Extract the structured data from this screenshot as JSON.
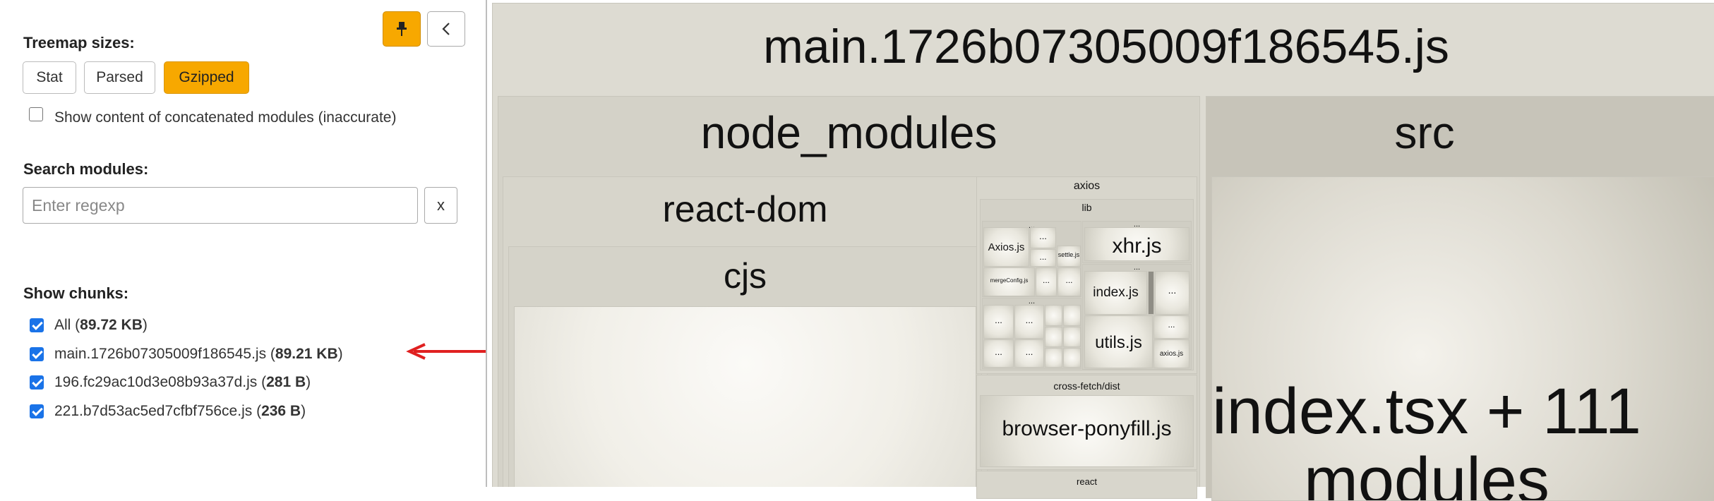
{
  "sidebar": {
    "treemap_sizes_label": "Treemap sizes:",
    "size_buttons": [
      {
        "label": "Stat",
        "active": false
      },
      {
        "label": "Parsed",
        "active": false
      },
      {
        "label": "Gzipped",
        "active": true
      }
    ],
    "concat_label": "Show content of concatenated modules (inaccurate)",
    "search_label": "Search modules:",
    "search_placeholder": "Enter regexp",
    "search_value": "",
    "clear_label": "x",
    "chunks_label": "Show chunks:",
    "chunks": [
      {
        "name": "All",
        "size": "89.72 KB",
        "checked": true
      },
      {
        "name": "main.1726b07305009f186545.js",
        "size": "89.21 KB",
        "checked": true
      },
      {
        "name": "196.fc29ac10d3e08b93a37d.js",
        "size": "281 B",
        "checked": true
      },
      {
        "name": "221.b7d53ac5ed7cfbf756ce.js",
        "size": "236 B",
        "checked": true
      }
    ],
    "pin_icon": "pin-icon",
    "collapse_icon": "chevron-left-icon",
    "accent_color": "#f7a800",
    "annotation_color": "#e02020"
  },
  "treemap": {
    "root": "main.1726b07305009f186545.js",
    "node_modules": "node_modules",
    "react_dom": "react-dom",
    "cjs": "cjs",
    "axios": "axios",
    "lib": "lib",
    "axios_js": "Axios.js",
    "merge_config": "mergeConfig.js",
    "xhr": "xhr.js",
    "index_js": "index.js",
    "utils_js": "utils.js",
    "axios_js_small": "axios.js",
    "settle": "settle.js",
    "ellipsis": "...",
    "cross_fetch": "cross-fetch/dist",
    "ponyfill": "browser-ponyfill.js",
    "react": "react",
    "src": "src",
    "index_tsx": "index.tsx + 111",
    "modules_word": "modules"
  }
}
